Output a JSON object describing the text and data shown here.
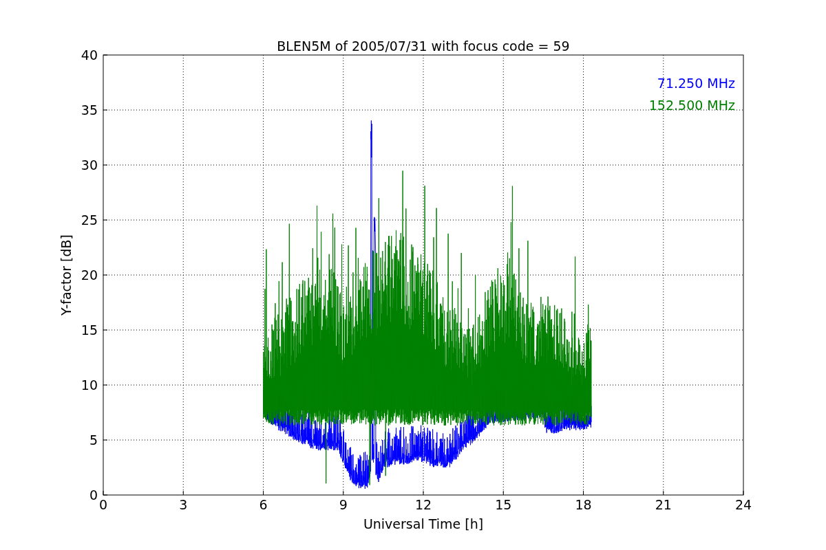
{
  "chart": {
    "title": "BLEN5M of 2005/07/31 with focus code = 59",
    "xlabel": "Universal Time [h]",
    "ylabel": "Y-factor [dB]",
    "xticks": [
      "0",
      "3",
      "6",
      "9",
      "12",
      "15",
      "18",
      "21",
      "24"
    ],
    "yticks": [
      "40",
      "35",
      "30",
      "25",
      "20",
      "15",
      "10",
      "5",
      "0"
    ],
    "legend": [
      {
        "label": "71.250 MHz",
        "color": "#0000ff"
      },
      {
        "label": "152.500 MHz",
        "color": "#008000"
      }
    ]
  }
}
